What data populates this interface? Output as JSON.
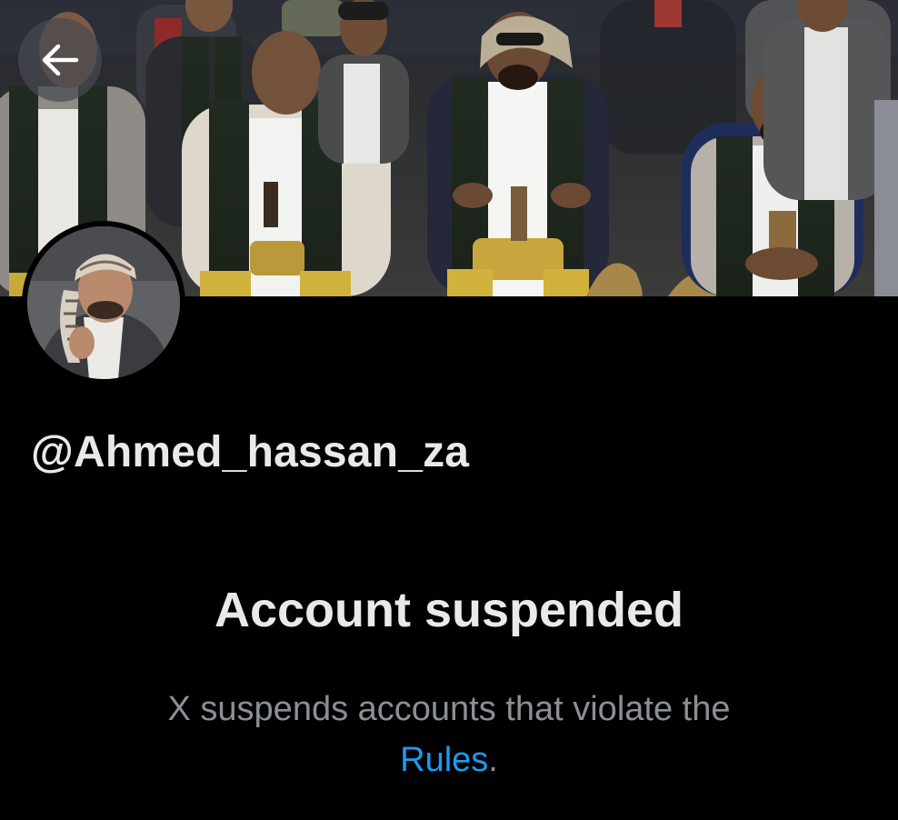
{
  "header": {
    "back_icon": "arrow-left-icon"
  },
  "profile": {
    "handle": "@Ahmed_hassan_za",
    "avatar_icon": "profile-photo"
  },
  "suspension": {
    "title": "Account suspended",
    "description_prefix": "X suspends accounts that violate the",
    "rules_link": "Rules",
    "description_suffix": "."
  },
  "colors": {
    "background": "#000000",
    "text_primary": "#e7e9ea",
    "text_secondary": "#8b9096",
    "link": "#1d9bf0"
  }
}
